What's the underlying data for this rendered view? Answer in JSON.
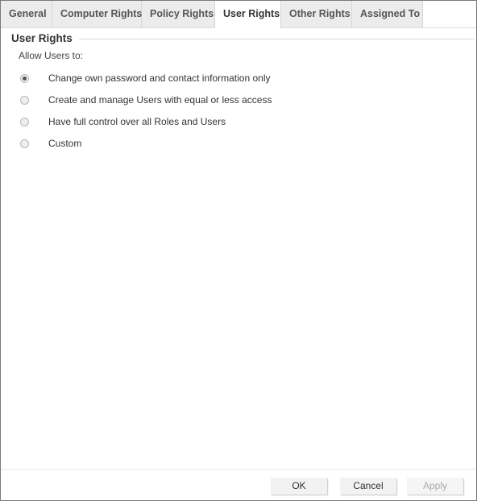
{
  "tabs": [
    {
      "label": "General",
      "active": false
    },
    {
      "label": "Computer Rights",
      "active": false
    },
    {
      "label": "Policy Rights",
      "active": false
    },
    {
      "label": "User Rights",
      "active": true
    },
    {
      "label": "Other Rights",
      "active": false
    },
    {
      "label": "Assigned To",
      "active": false
    }
  ],
  "section": {
    "title": "User Rights",
    "allow_label": "Allow Users to:",
    "options": [
      {
        "label": "Change own password and contact information only",
        "checked": true
      },
      {
        "label": "Create and manage Users with equal or less access",
        "checked": false
      },
      {
        "label": "Have full control over all Roles and Users",
        "checked": false
      },
      {
        "label": "Custom",
        "checked": false
      }
    ]
  },
  "buttons": {
    "ok": "OK",
    "cancel": "Cancel",
    "apply": "Apply",
    "apply_disabled": true
  }
}
